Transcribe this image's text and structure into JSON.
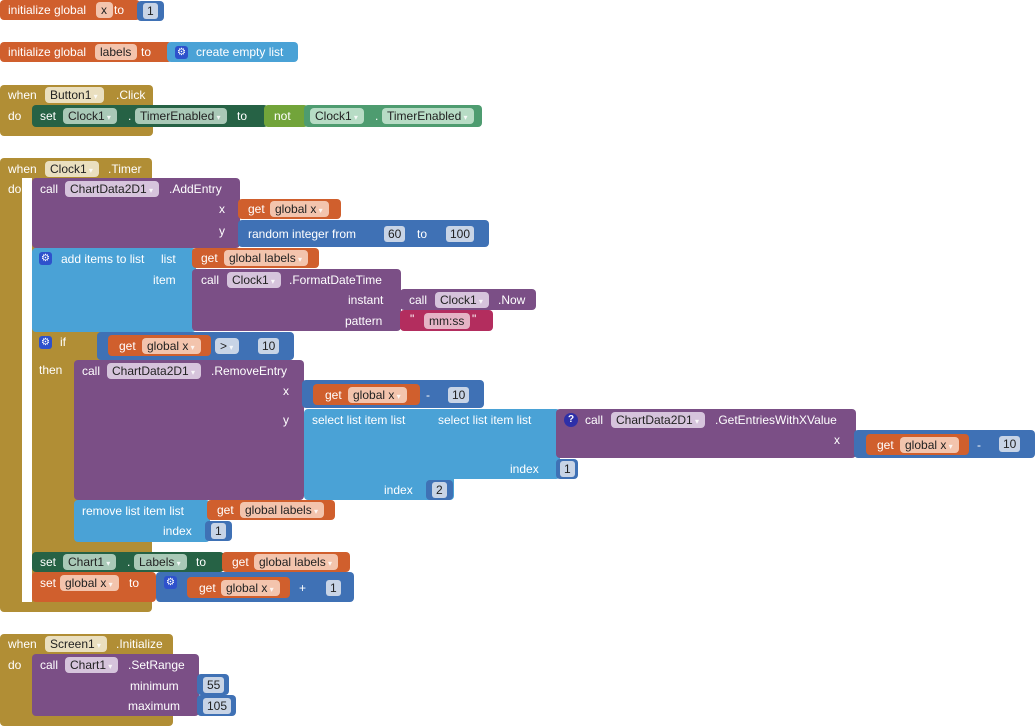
{
  "blocks": {
    "init_x": {
      "kw": "initialize global",
      "name": "x",
      "to": "to",
      "value": "1"
    },
    "init_labels": {
      "kw": "initialize global",
      "name": "labels",
      "to": "to",
      "value": "create empty list"
    },
    "button_click": {
      "when": "when",
      "component": "Button1",
      "event": ".Click",
      "do": "do",
      "set": "set",
      "set_component": "Clock1",
      "dot": ".",
      "property": "TimerEnabled",
      "to": "to",
      "not": "not",
      "get_component": "Clock1",
      "get_property": "TimerEnabled"
    },
    "clock_timer": {
      "when": "when",
      "component": "Clock1",
      "event": ".Timer",
      "do": "do",
      "add_entry": {
        "call": "call",
        "component": "ChartData2D1",
        "method": ".AddEntry",
        "x_label": "x",
        "y_label": "y",
        "get": "get",
        "var": "global x",
        "random": "random integer from",
        "from": "60",
        "to": "to",
        "to_value": "100"
      },
      "add_items": {
        "label": "add items to list",
        "list_label": "list",
        "item_label": "item",
        "get": "get",
        "var": "global labels",
        "call": "call",
        "component": "Clock1",
        "method": ".FormatDateTime",
        "instant_label": "instant",
        "pattern_label": "pattern",
        "now_call": "call",
        "now_component": "Clock1",
        "now_method": ".Now",
        "quote": "\"",
        "pattern": "mm:ss"
      },
      "if_block": {
        "if": "if",
        "then": "then",
        "get": "get",
        "var": "global x",
        "op": ">",
        "value": "10"
      },
      "remove_entry": {
        "call": "call",
        "component": "ChartData2D1",
        "method": ".RemoveEntry",
        "x_label": "x",
        "y_label": "y",
        "get": "get",
        "var": "global x",
        "minus": "-",
        "value": "10",
        "select1": "select list item  list",
        "select2": "select list item  list",
        "index_label": "index",
        "index_outer": "2",
        "index_inner": "1",
        "gewx_call": "call",
        "gewx_component": "ChartData2D1",
        "gewx_method": ".GetEntriesWithXValue",
        "gewx_x": "x",
        "gewx_get": "get",
        "gewx_var": "global x",
        "gewx_minus": "-",
        "gewx_value": "10"
      },
      "remove_item": {
        "label": "remove list item  list",
        "index_label": "index",
        "get": "get",
        "var": "global labels",
        "index": "1"
      },
      "set_labels": {
        "set": "set",
        "component": "Chart1",
        "dot": ".",
        "property": "Labels",
        "to": "to",
        "get": "get",
        "var": "global labels"
      },
      "set_x": {
        "set": "set",
        "var": "global x",
        "to": "to",
        "get": "get",
        "get_var": "global x",
        "plus": "+",
        "value": "1"
      }
    },
    "screen_init": {
      "when": "when",
      "component": "Screen1",
      "event": ".Initialize",
      "do": "do",
      "call": "call",
      "call_component": "Chart1",
      "method": ".SetRange",
      "min_label": "minimum",
      "min_value": "55",
      "max_label": "maximum",
      "max_value": "105"
    }
  }
}
